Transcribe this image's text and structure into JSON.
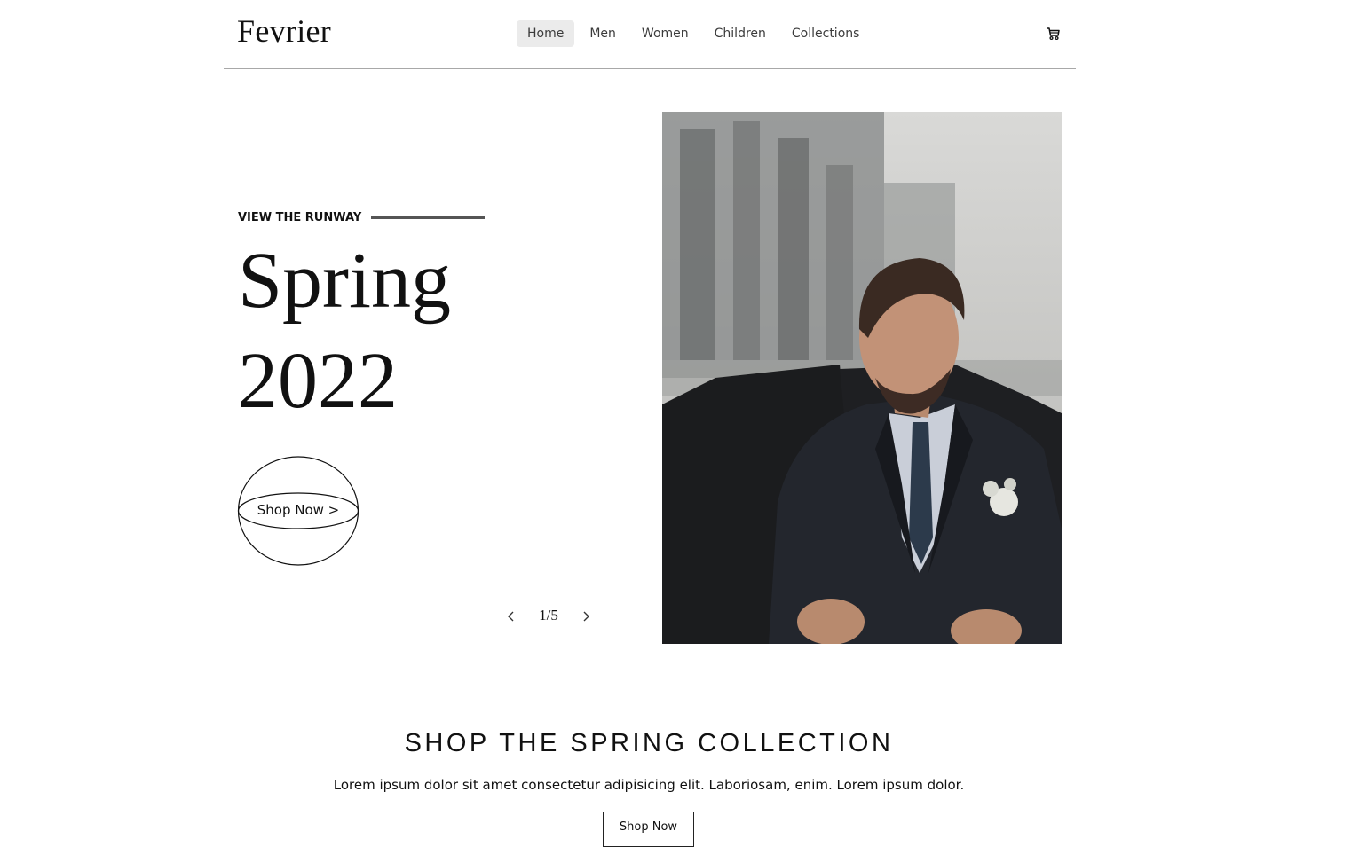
{
  "header": {
    "logo": "Fevrier",
    "nav": [
      "Home",
      "Men",
      "Women",
      "Children",
      "Collections"
    ],
    "active_nav": "Home",
    "cart_icon": "cart-icon"
  },
  "hero": {
    "eyebrow": "VIEW THE RUNWAY",
    "title_line1": "Spring",
    "title_line2": "2022",
    "cta": "Shop Now >",
    "pager": "1/5",
    "image_subject": "man in dark suit adjusting jacket beside car"
  },
  "section": {
    "title": "SHOP THE SPRING COLLECTION",
    "description": "Lorem ipsum dolor sit amet consectetur adipisicing elit. Laboriosam, enim. Lorem ipsum dolor.",
    "button": "Shop Now"
  },
  "colors": {
    "text": "#111111",
    "nav_active_bg": "#ebebeb",
    "divider": "#a8a8a8"
  }
}
